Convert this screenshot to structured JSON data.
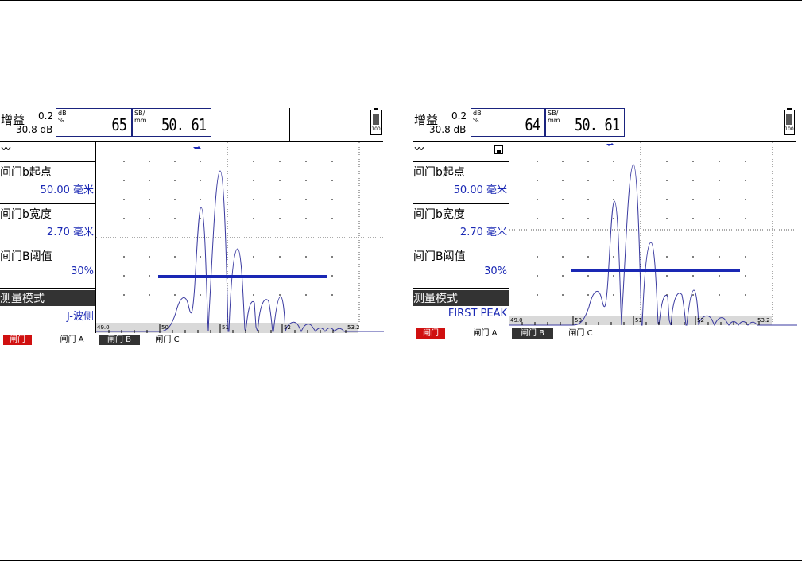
{
  "colors": {
    "gate_line": "#1a28b4",
    "waveform": "#3a3aa0",
    "gate_red": "#d01010",
    "param_value": "#1a28b4"
  },
  "screens": [
    {
      "gain_label": "增益",
      "gain_step": "0.2",
      "gain_db": "30.8 dB",
      "box1_unit1": "dB",
      "box1_unit2": "%",
      "box1_value": "65",
      "box2_unit1": "SB/",
      "box2_unit2": "mm",
      "box2_value": "50. 61",
      "battery_pct": "100",
      "icons": [
        "waveform-icon"
      ],
      "params": [
        {
          "label": "间门b起点",
          "value": "50.00 毫米"
        },
        {
          "label": "间门b宽度",
          "value": "2.70 毫米"
        },
        {
          "label": "间门B阈值",
          "value": "30%"
        },
        {
          "label": "测量模式",
          "value": "J-波侧"
        }
      ],
      "axis": {
        "start": "49.0",
        "t1": "50",
        "t2": "51",
        "t3": "52",
        "end": "53.2"
      },
      "gates": {
        "red": "闸门",
        "a": "闸门 A",
        "b": "闸门 B",
        "c": "闸门 C"
      }
    },
    {
      "gain_label": "增益",
      "gain_step": "0.2",
      "gain_db": "30.8 dB",
      "box1_unit1": "dB",
      "box1_unit2": "%",
      "box1_value": "64",
      "box2_unit1": "SB/",
      "box2_unit2": "mm",
      "box2_value": "50. 61",
      "battery_pct": "100",
      "icons": [
        "waveform-icon",
        "save-icon"
      ],
      "params": [
        {
          "label": "间门b起点",
          "value": "50.00 毫米"
        },
        {
          "label": "间门b宽度",
          "value": "2.70 毫米"
        },
        {
          "label": "间门B阈值",
          "value": "30%"
        },
        {
          "label": "测量模式",
          "value": "FIRST PEAK"
        }
      ],
      "axis": {
        "start": "49.0",
        "t1": "50",
        "t2": "51",
        "t3": "52",
        "end": "53.2"
      },
      "gates": {
        "red": "闸门",
        "a": "闸门 A",
        "b": "闸门 B",
        "c": "闸门 C"
      }
    }
  ]
}
